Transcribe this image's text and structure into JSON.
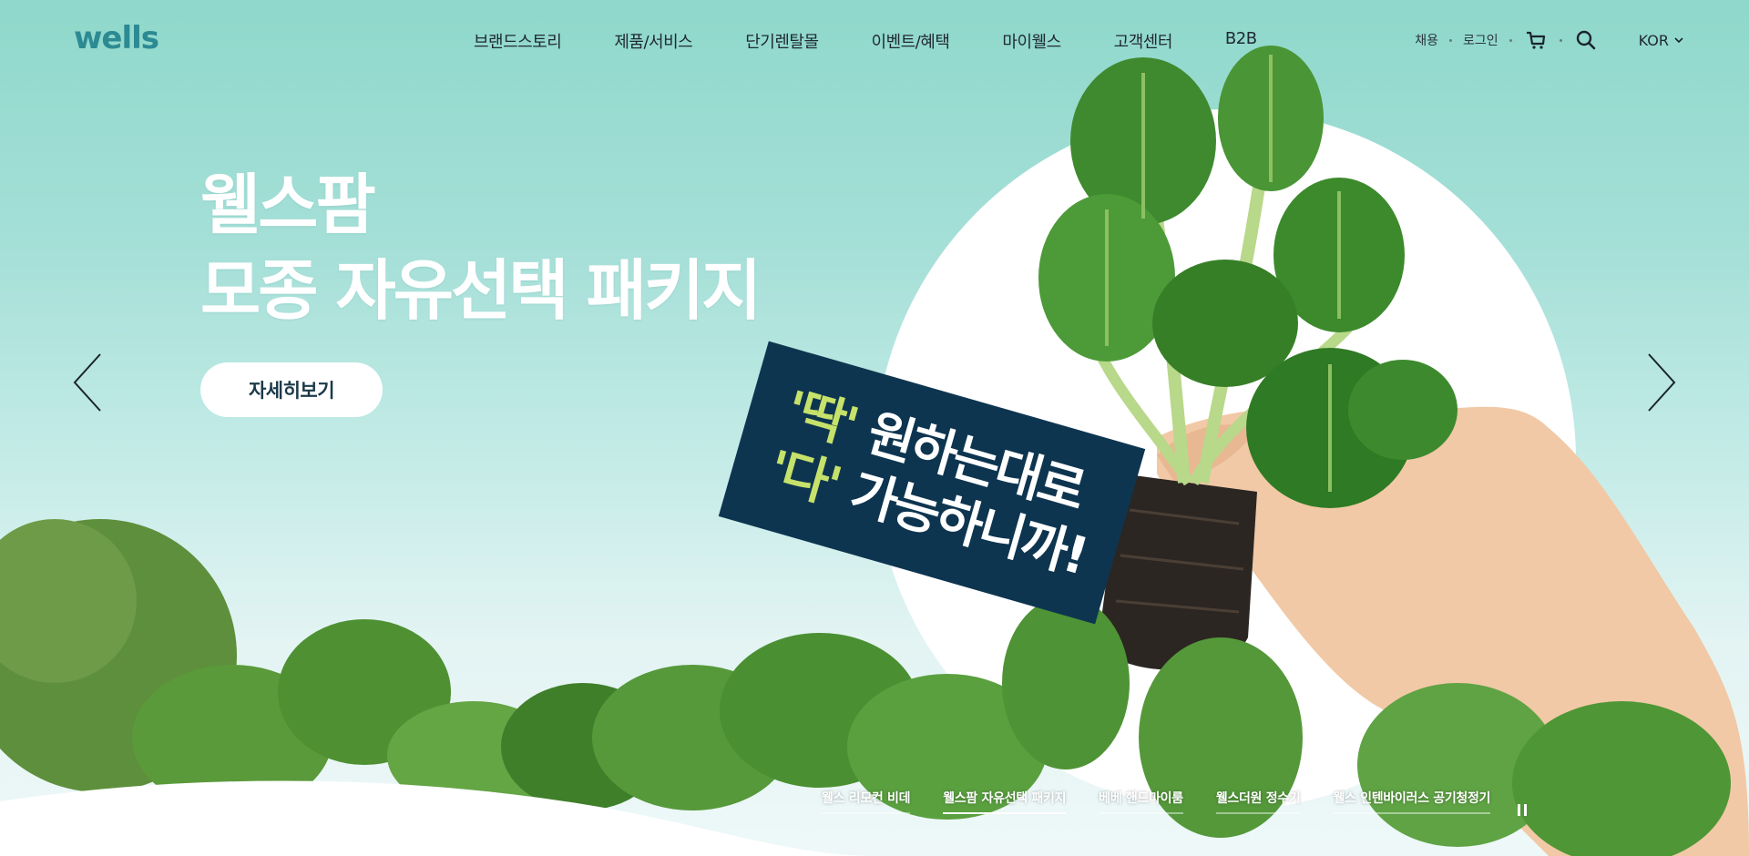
{
  "brand": {
    "logo": "wells"
  },
  "nav": {
    "items": [
      "브랜드스토리",
      "제품/서비스",
      "단기렌탈몰",
      "이벤트/혜택",
      "마이웰스",
      "고객센터",
      "B2B"
    ]
  },
  "util": {
    "recruit": "채용",
    "login": "로그인",
    "cart_icon": "cart-icon",
    "search_icon": "search-icon",
    "language": "KOR"
  },
  "hero": {
    "headline_line1": "웰스팜",
    "headline_line2": "모종 자유선택 패키지",
    "cta_label": "자세히보기",
    "badge_hl1": "'딱'",
    "badge_text1": " 원하는대로",
    "badge_hl2": "'다'",
    "badge_text2": " 가능하니까!"
  },
  "slides": {
    "items": [
      "웰스 리모컨 비데",
      "웰스팜 자유선택 패키지",
      "베베 핸드마이룸",
      "웰스더원 정수기",
      "웰스 인텐바이러스 공기청정기"
    ],
    "active_index": 1,
    "pause_icon": "pause-icon"
  },
  "colors": {
    "logo": "#2c8a93",
    "badge_bg": "#0e3550",
    "badge_highlight": "#c6e26a",
    "hero_top": "#8fd8cb"
  }
}
